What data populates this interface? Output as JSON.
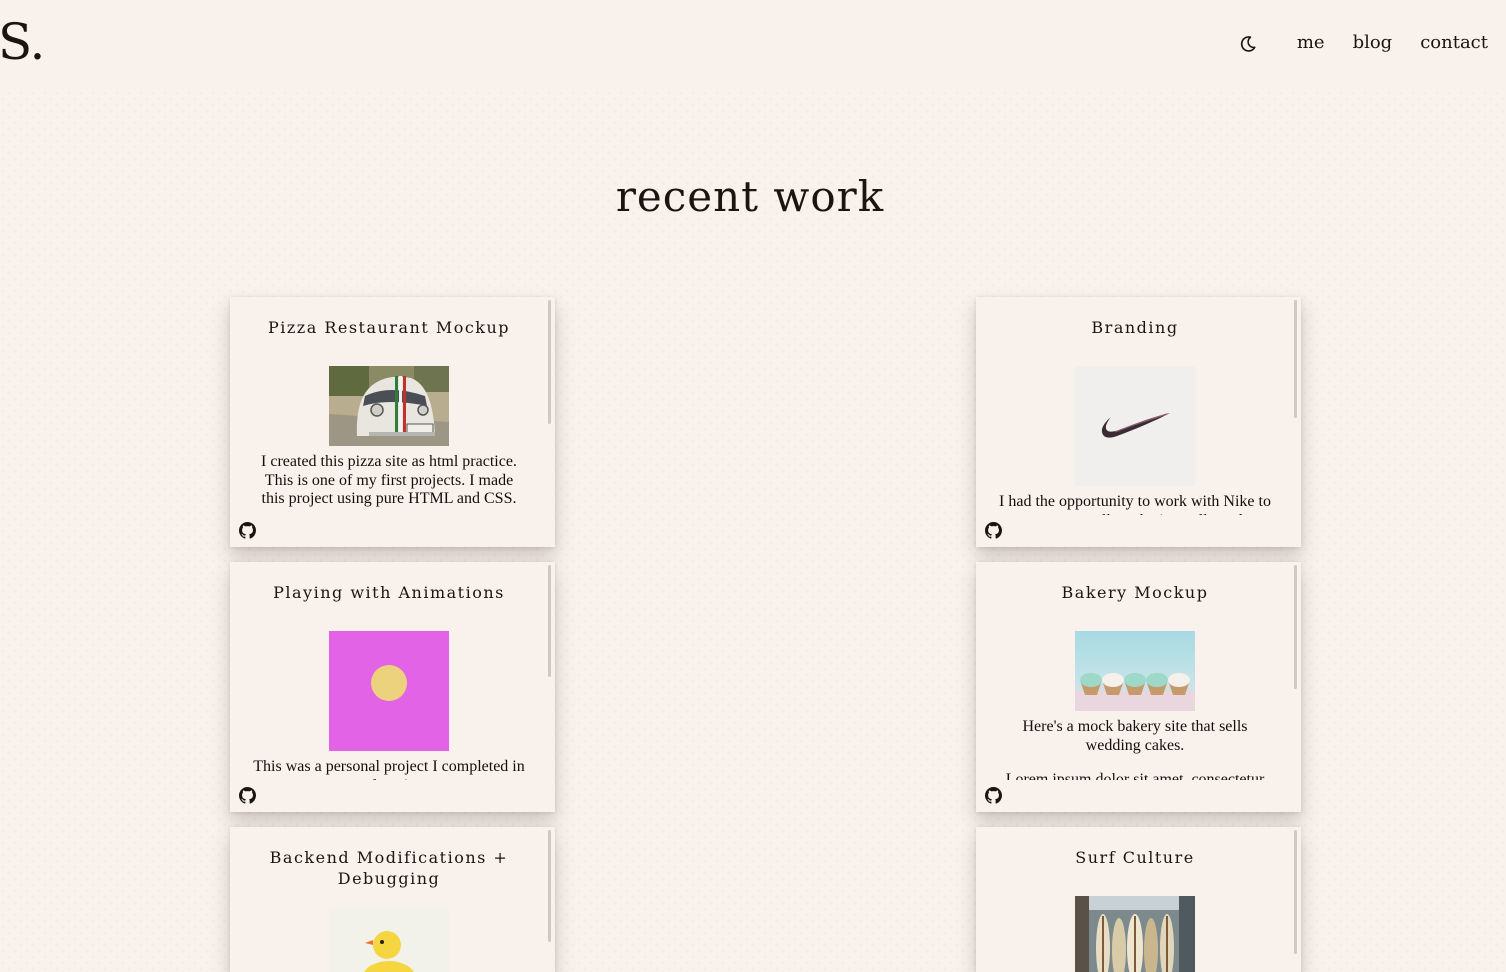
{
  "header": {
    "logo": "S.",
    "theme_toggle_icon": "moon-icon",
    "nav": [
      {
        "label": "me"
      },
      {
        "label": "blog"
      },
      {
        "label": "contact"
      }
    ]
  },
  "section": {
    "title": "recent work"
  },
  "projects": [
    {
      "title": "Pizza Restaurant Mockup",
      "description": "I created this pizza site as html practice. This is one of my first projects. I made this project using pure HTML and CSS.",
      "link_icon": "github-icon"
    },
    {
      "title": "Branding",
      "description": "I had the opportunity to work with Nike to create a small marketing collateral.",
      "link_icon": "github-icon"
    },
    {
      "title": "Playing with Animations",
      "description": "This was a personal project I completed in my free time.",
      "link_icon": "github-icon"
    },
    {
      "title": "Bakery Mockup",
      "description": "Here's a mock bakery site that sells wedding cakes.",
      "extra": "Lorem ipsum dolor sit amet, consectetur",
      "link_icon": "github-icon"
    },
    {
      "title": "Backend Modifications + Debugging",
      "description": "",
      "link_icon": "github-icon"
    },
    {
      "title": "Surf Culture",
      "description": "",
      "link_icon": "github-icon"
    }
  ],
  "colors": {
    "background": "#f9f1ec",
    "text": "#1c140f",
    "animation_bg": "#e263e6",
    "animation_dot": "#ecd27c"
  }
}
